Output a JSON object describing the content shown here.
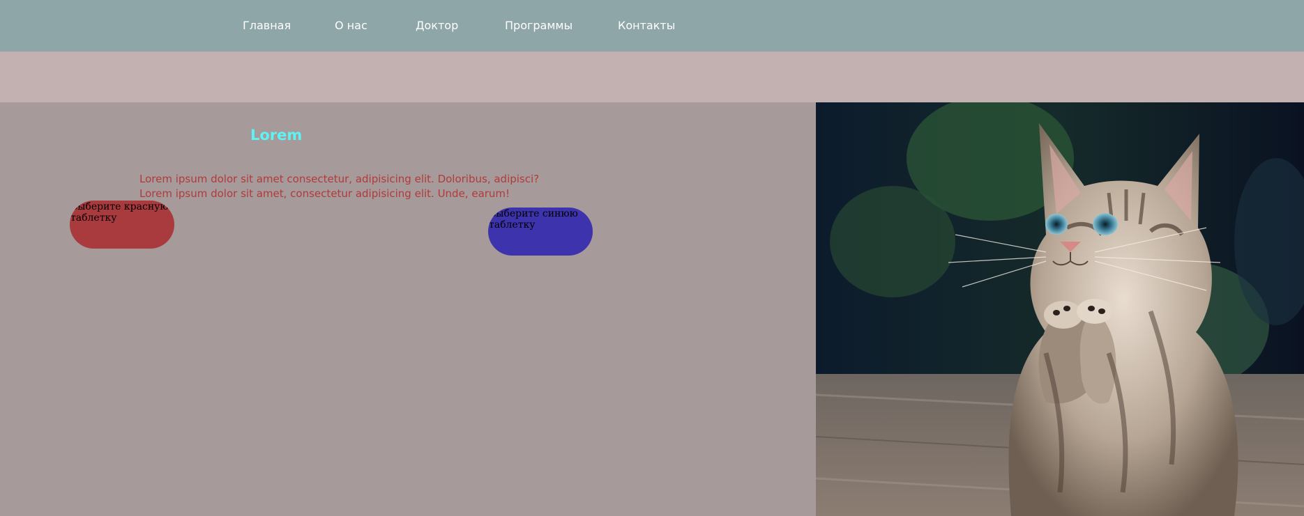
{
  "nav": {
    "items": [
      "Главная",
      "О нас",
      "Доктор",
      "Программы",
      "Контакты"
    ]
  },
  "main": {
    "heading": "Lorem",
    "paragraph_line1": "Lorem ipsum dolor sit amet consectetur, adipisicing elit. Doloribus, adipisci?",
    "paragraph_line2": "Lorem ipsum dolor sit amet, consectetur adipisicing elit. Unde, earum!",
    "red_pill_label": "Выберите красную таблетку",
    "blue_pill_label": "Выберите синюю таблетку"
  },
  "photo": {
    "icon": "kitten-photo"
  },
  "colors": {
    "nav_bg": "#8fa6a8",
    "band_bg": "#c3b0b0",
    "content_bg": "#a69a9a",
    "heading": "#5ff2f2",
    "paragraph": "#b23a3a",
    "red_pill": "#a93a3d",
    "blue_pill": "#3d34ad"
  }
}
